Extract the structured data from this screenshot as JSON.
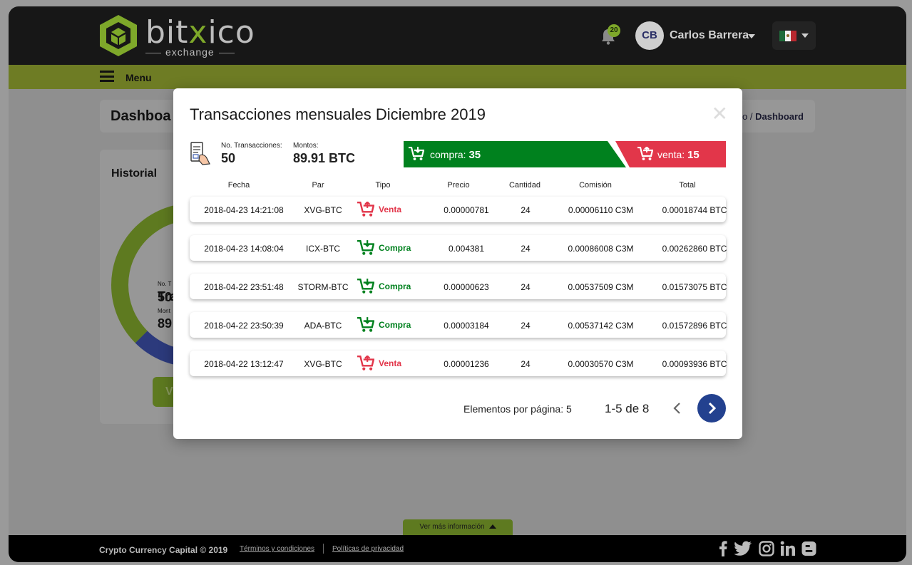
{
  "header": {
    "logo_main_prefix": "bit",
    "logo_main_x": "x",
    "logo_main_suffix": "ico",
    "logo_sub": "exchange",
    "notifications_count": "20",
    "user_initials": "CB",
    "user_name": "Carlos Barrera",
    "brand_color": "#7ea82a"
  },
  "menu": {
    "label": "Menu"
  },
  "background_page": {
    "title": "Dashboa",
    "breadcrumb_prefix": "io / ",
    "breadcrumb_current": "Dashboard",
    "history_title": "Historial",
    "frag1": "Tra",
    "frag2": "No. T",
    "frag3": "50",
    "frag4": "Mont",
    "frag5": "89",
    "frag6": "V"
  },
  "modal": {
    "title": "Transacciones mensuales Diciembre 2019",
    "close_glyph": "✕",
    "stats": {
      "transactions_label": "No. Transacciones:",
      "transactions_value": "50",
      "amount_label": "Montos:",
      "amount_value": "89.91 BTC"
    },
    "compra_label": "compra:",
    "compra_value": "35",
    "venta_label": "venta:",
    "venta_value": "15",
    "columns": [
      "Fecha",
      "Par",
      "Tipo",
      "Precio",
      "Cantidad",
      "Comisión",
      "Total"
    ],
    "rows": [
      {
        "fecha": "2018-04-23 14:21:08",
        "par": "XVG-BTC",
        "tipo": "Venta",
        "precio": "0.00000781",
        "cantidad": "24",
        "comision": "0.00006110 C3M",
        "total": "0.00018744 BTC"
      },
      {
        "fecha": "2018-04-23 14:08:04",
        "par": "ICX-BTC",
        "tipo": "Compra",
        "precio": "0.004381",
        "cantidad": "24",
        "comision": "0.00086008 C3M",
        "total": "0.00262860 BTC"
      },
      {
        "fecha": "2018-04-22 23:51:48",
        "par": "STORM-BTC",
        "tipo": "Compra",
        "precio": "0.00000623",
        "cantidad": "24",
        "comision": "0.00537509 C3M",
        "total": "0.01573075 BTC"
      },
      {
        "fecha": "2018-04-22 23:50:39",
        "par": "ADA-BTC",
        "tipo": "Compra",
        "precio": "0.00003184",
        "cantidad": "24",
        "comision": "0.00537142 C3M",
        "total": "0.01572896 BTC"
      },
      {
        "fecha": "2018-04-22 13:12:47",
        "par": "XVG-BTC",
        "tipo": "Venta",
        "precio": "0.00001236",
        "cantidad": "24",
        "comision": "0.00030570 C3M",
        "total": "0.00093936 BTC"
      }
    ],
    "pager": {
      "per_page_label": "Elementos por página: 5",
      "range": "1-5 de 8"
    },
    "colors": {
      "compra": "#00811e",
      "venta": "#e2364a",
      "pager_active": "#23418f"
    }
  },
  "footer": {
    "ver_mas": "Ver más información",
    "copyright": "Crypto Currency Capital © 2019",
    "terms": "Términos y condiciones",
    "privacy": "Políticas de privacidad",
    "social": [
      "facebook-icon",
      "twitter-icon",
      "instagram-icon",
      "linkedin-icon",
      "blogger-icon"
    ]
  }
}
